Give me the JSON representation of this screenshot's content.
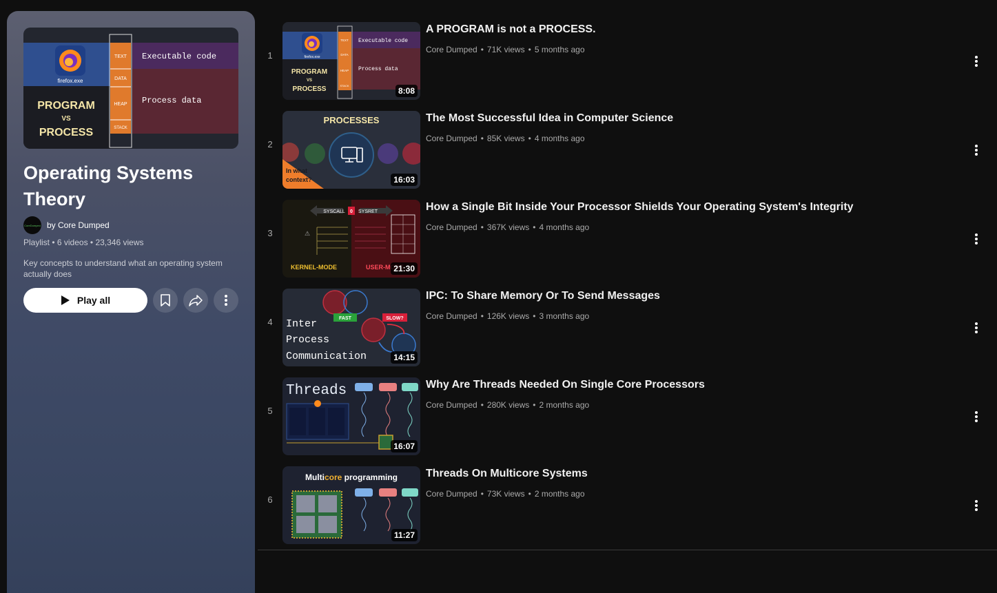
{
  "playlist": {
    "title": "Operating Systems Theory",
    "owner": "by Core Dumped",
    "avatar_text": "CoreDumped",
    "meta": "Playlist • 6 videos • 23,346 views",
    "description": "Key concepts to understand what an operating system actually does",
    "play_all_label": "Play all",
    "cover": {
      "exe_label": "firefox.exe",
      "left_lines": [
        "PROGRAM",
        "VS",
        "PROCESS"
      ],
      "segments": [
        "TEXT",
        "DATA",
        "HEAP",
        "STACK"
      ],
      "executable_label": "Executable code",
      "process_label": "Process data"
    },
    "icons": {
      "play": "play-icon",
      "save": "bookmark-icon",
      "share": "share-icon",
      "more": "more-vert-icon"
    }
  },
  "videos": [
    {
      "index": "1",
      "title": "A PROGRAM is not a PROCESS.",
      "channel": "Core Dumped",
      "views": "71K views",
      "age": "5 months ago",
      "duration": "8:08",
      "thumb": {
        "exe_label": "firefox.exe",
        "left_lines": [
          "PROGRAM",
          "VS",
          "PROCESS"
        ],
        "segments": [
          "TEXT",
          "DATA",
          "HEAP",
          "STACK"
        ],
        "executable_label": "Executable code",
        "process_label": "Process data"
      }
    },
    {
      "index": "2",
      "title": "The Most Successful Idea in Computer Science",
      "channel": "Core Dumped",
      "views": "85K views",
      "age": "4 months ago",
      "duration": "16:03",
      "thumb": {
        "heading": "PROCESSES",
        "corner_lines": [
          "In what",
          "context?"
        ]
      }
    },
    {
      "index": "3",
      "title": "How a Single Bit Inside Your Processor Shields Your Operating System's Integrity",
      "channel": "Core Dumped",
      "views": "367K views",
      "age": "4 months ago",
      "duration": "21:30",
      "thumb": {
        "syscall": "SYSCALL",
        "bit": "0",
        "sysret": "SYSRET",
        "left_mode": "KERNEL-MODE",
        "right_mode": "USER-MODE"
      }
    },
    {
      "index": "4",
      "title": "IPC: To Share Memory Or To Send Messages",
      "channel": "Core Dumped",
      "views": "126K views",
      "age": "3 months ago",
      "duration": "14:15",
      "thumb": {
        "fast": "FAST",
        "slow": "SLOW?",
        "lines": [
          "Inter",
          "Process",
          "Communication"
        ]
      }
    },
    {
      "index": "5",
      "title": "Why Are Threads Needed On Single Core Processors",
      "channel": "Core Dumped",
      "views": "280K views",
      "age": "2 months ago",
      "duration": "16:07",
      "thumb": {
        "heading": "Threads"
      }
    },
    {
      "index": "6",
      "title": "Threads On Multicore Systems",
      "channel": "Core Dumped",
      "views": "73K views",
      "age": "2 months ago",
      "duration": "11:27",
      "thumb": {
        "heading_pre": "Multi",
        "heading_accent": "core",
        "heading_post": " programming"
      }
    }
  ]
}
